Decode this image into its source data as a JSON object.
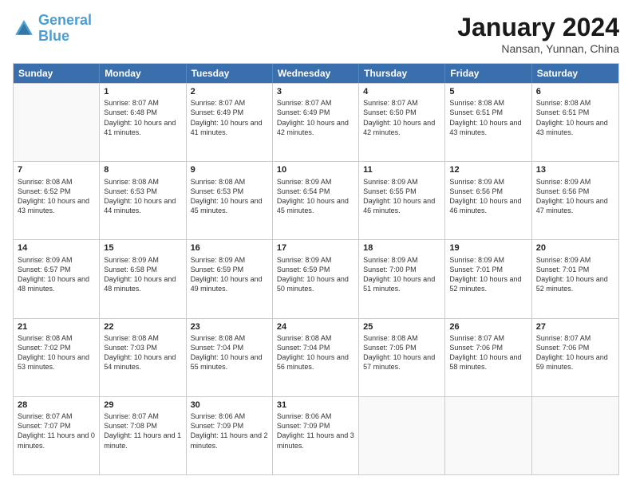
{
  "logo": {
    "line1": "General",
    "line2": "Blue"
  },
  "title": "January 2024",
  "subtitle": "Nansan, Yunnan, China",
  "header_days": [
    "Sunday",
    "Monday",
    "Tuesday",
    "Wednesday",
    "Thursday",
    "Friday",
    "Saturday"
  ],
  "rows": [
    [
      {
        "day": "",
        "empty": true
      },
      {
        "day": "1",
        "sunrise": "Sunrise: 8:07 AM",
        "sunset": "Sunset: 6:48 PM",
        "daylight": "Daylight: 10 hours and 41 minutes."
      },
      {
        "day": "2",
        "sunrise": "Sunrise: 8:07 AM",
        "sunset": "Sunset: 6:49 PM",
        "daylight": "Daylight: 10 hours and 41 minutes."
      },
      {
        "day": "3",
        "sunrise": "Sunrise: 8:07 AM",
        "sunset": "Sunset: 6:49 PM",
        "daylight": "Daylight: 10 hours and 42 minutes."
      },
      {
        "day": "4",
        "sunrise": "Sunrise: 8:07 AM",
        "sunset": "Sunset: 6:50 PM",
        "daylight": "Daylight: 10 hours and 42 minutes."
      },
      {
        "day": "5",
        "sunrise": "Sunrise: 8:08 AM",
        "sunset": "Sunset: 6:51 PM",
        "daylight": "Daylight: 10 hours and 43 minutes."
      },
      {
        "day": "6",
        "sunrise": "Sunrise: 8:08 AM",
        "sunset": "Sunset: 6:51 PM",
        "daylight": "Daylight: 10 hours and 43 minutes."
      }
    ],
    [
      {
        "day": "7",
        "sunrise": "Sunrise: 8:08 AM",
        "sunset": "Sunset: 6:52 PM",
        "daylight": "Daylight: 10 hours and 43 minutes."
      },
      {
        "day": "8",
        "sunrise": "Sunrise: 8:08 AM",
        "sunset": "Sunset: 6:53 PM",
        "daylight": "Daylight: 10 hours and 44 minutes."
      },
      {
        "day": "9",
        "sunrise": "Sunrise: 8:08 AM",
        "sunset": "Sunset: 6:53 PM",
        "daylight": "Daylight: 10 hours and 45 minutes."
      },
      {
        "day": "10",
        "sunrise": "Sunrise: 8:09 AM",
        "sunset": "Sunset: 6:54 PM",
        "daylight": "Daylight: 10 hours and 45 minutes."
      },
      {
        "day": "11",
        "sunrise": "Sunrise: 8:09 AM",
        "sunset": "Sunset: 6:55 PM",
        "daylight": "Daylight: 10 hours and 46 minutes."
      },
      {
        "day": "12",
        "sunrise": "Sunrise: 8:09 AM",
        "sunset": "Sunset: 6:56 PM",
        "daylight": "Daylight: 10 hours and 46 minutes."
      },
      {
        "day": "13",
        "sunrise": "Sunrise: 8:09 AM",
        "sunset": "Sunset: 6:56 PM",
        "daylight": "Daylight: 10 hours and 47 minutes."
      }
    ],
    [
      {
        "day": "14",
        "sunrise": "Sunrise: 8:09 AM",
        "sunset": "Sunset: 6:57 PM",
        "daylight": "Daylight: 10 hours and 48 minutes."
      },
      {
        "day": "15",
        "sunrise": "Sunrise: 8:09 AM",
        "sunset": "Sunset: 6:58 PM",
        "daylight": "Daylight: 10 hours and 48 minutes."
      },
      {
        "day": "16",
        "sunrise": "Sunrise: 8:09 AM",
        "sunset": "Sunset: 6:59 PM",
        "daylight": "Daylight: 10 hours and 49 minutes."
      },
      {
        "day": "17",
        "sunrise": "Sunrise: 8:09 AM",
        "sunset": "Sunset: 6:59 PM",
        "daylight": "Daylight: 10 hours and 50 minutes."
      },
      {
        "day": "18",
        "sunrise": "Sunrise: 8:09 AM",
        "sunset": "Sunset: 7:00 PM",
        "daylight": "Daylight: 10 hours and 51 minutes."
      },
      {
        "day": "19",
        "sunrise": "Sunrise: 8:09 AM",
        "sunset": "Sunset: 7:01 PM",
        "daylight": "Daylight: 10 hours and 52 minutes."
      },
      {
        "day": "20",
        "sunrise": "Sunrise: 8:09 AM",
        "sunset": "Sunset: 7:01 PM",
        "daylight": "Daylight: 10 hours and 52 minutes."
      }
    ],
    [
      {
        "day": "21",
        "sunrise": "Sunrise: 8:08 AM",
        "sunset": "Sunset: 7:02 PM",
        "daylight": "Daylight: 10 hours and 53 minutes."
      },
      {
        "day": "22",
        "sunrise": "Sunrise: 8:08 AM",
        "sunset": "Sunset: 7:03 PM",
        "daylight": "Daylight: 10 hours and 54 minutes."
      },
      {
        "day": "23",
        "sunrise": "Sunrise: 8:08 AM",
        "sunset": "Sunset: 7:04 PM",
        "daylight": "Daylight: 10 hours and 55 minutes."
      },
      {
        "day": "24",
        "sunrise": "Sunrise: 8:08 AM",
        "sunset": "Sunset: 7:04 PM",
        "daylight": "Daylight: 10 hours and 56 minutes."
      },
      {
        "day": "25",
        "sunrise": "Sunrise: 8:08 AM",
        "sunset": "Sunset: 7:05 PM",
        "daylight": "Daylight: 10 hours and 57 minutes."
      },
      {
        "day": "26",
        "sunrise": "Sunrise: 8:07 AM",
        "sunset": "Sunset: 7:06 PM",
        "daylight": "Daylight: 10 hours and 58 minutes."
      },
      {
        "day": "27",
        "sunrise": "Sunrise: 8:07 AM",
        "sunset": "Sunset: 7:06 PM",
        "daylight": "Daylight: 10 hours and 59 minutes."
      }
    ],
    [
      {
        "day": "28",
        "sunrise": "Sunrise: 8:07 AM",
        "sunset": "Sunset: 7:07 PM",
        "daylight": "Daylight: 11 hours and 0 minutes."
      },
      {
        "day": "29",
        "sunrise": "Sunrise: 8:07 AM",
        "sunset": "Sunset: 7:08 PM",
        "daylight": "Daylight: 11 hours and 1 minute."
      },
      {
        "day": "30",
        "sunrise": "Sunrise: 8:06 AM",
        "sunset": "Sunset: 7:09 PM",
        "daylight": "Daylight: 11 hours and 2 minutes."
      },
      {
        "day": "31",
        "sunrise": "Sunrise: 8:06 AM",
        "sunset": "Sunset: 7:09 PM",
        "daylight": "Daylight: 11 hours and 3 minutes."
      },
      {
        "day": "",
        "empty": true
      },
      {
        "day": "",
        "empty": true
      },
      {
        "day": "",
        "empty": true
      }
    ]
  ]
}
